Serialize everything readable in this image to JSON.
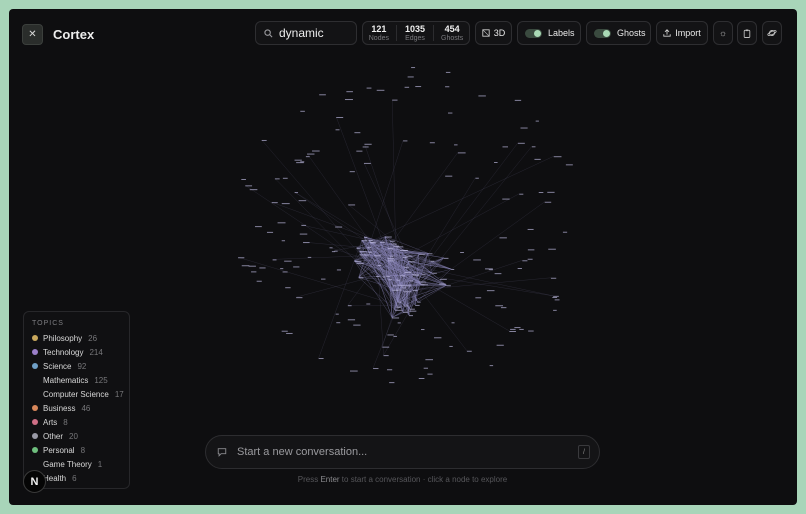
{
  "app": {
    "name": "Cortex"
  },
  "search": {
    "value": "dynamic"
  },
  "stats": [
    {
      "value": "121",
      "label": "Nodes"
    },
    {
      "value": "1035",
      "label": "Edges"
    },
    {
      "value": "454",
      "label": "Ghosts"
    }
  ],
  "toolbar": {
    "mode_label": "3D",
    "labels_label": "Labels",
    "labels_on": true,
    "ghosts_label": "Ghosts",
    "ghosts_on": true,
    "import_label": "Import",
    "icons": [
      "sun-icon",
      "clipboard-icon",
      "planet-icon"
    ]
  },
  "topics": {
    "title": "TOPICS",
    "items": [
      {
        "name": "Philosophy",
        "count": "26",
        "color": "#c9a85c"
      },
      {
        "name": "Technology",
        "count": "214",
        "color": "#9b7fc9"
      },
      {
        "name": "Science",
        "count": "92",
        "color": "#6f9fc6"
      },
      {
        "name": "Mathematics",
        "count": "125",
        "color": ""
      },
      {
        "name": "Computer Science",
        "count": "17",
        "color": ""
      },
      {
        "name": "Business",
        "count": "46",
        "color": "#d8875a"
      },
      {
        "name": "Arts",
        "count": "8",
        "color": "#cf6f86"
      },
      {
        "name": "Other",
        "count": "20",
        "color": "#9a9aa6"
      },
      {
        "name": "Personal",
        "count": "8",
        "color": "#6fbf7e"
      },
      {
        "name": "Game Theory",
        "count": "1",
        "color": ""
      },
      {
        "name": "Health",
        "count": "6",
        "color": ""
      }
    ]
  },
  "chat": {
    "placeholder": "Start a new conversation...",
    "shortcut": "/"
  },
  "hint": {
    "prefix": "Press ",
    "key": "Enter",
    "suffix": " to start a conversation · click a node to explore"
  },
  "badge": {
    "letter": "N"
  },
  "colors": {
    "accent": "#a9d9b5",
    "node": "#b7b3d8",
    "edge": "#8a86b8"
  }
}
